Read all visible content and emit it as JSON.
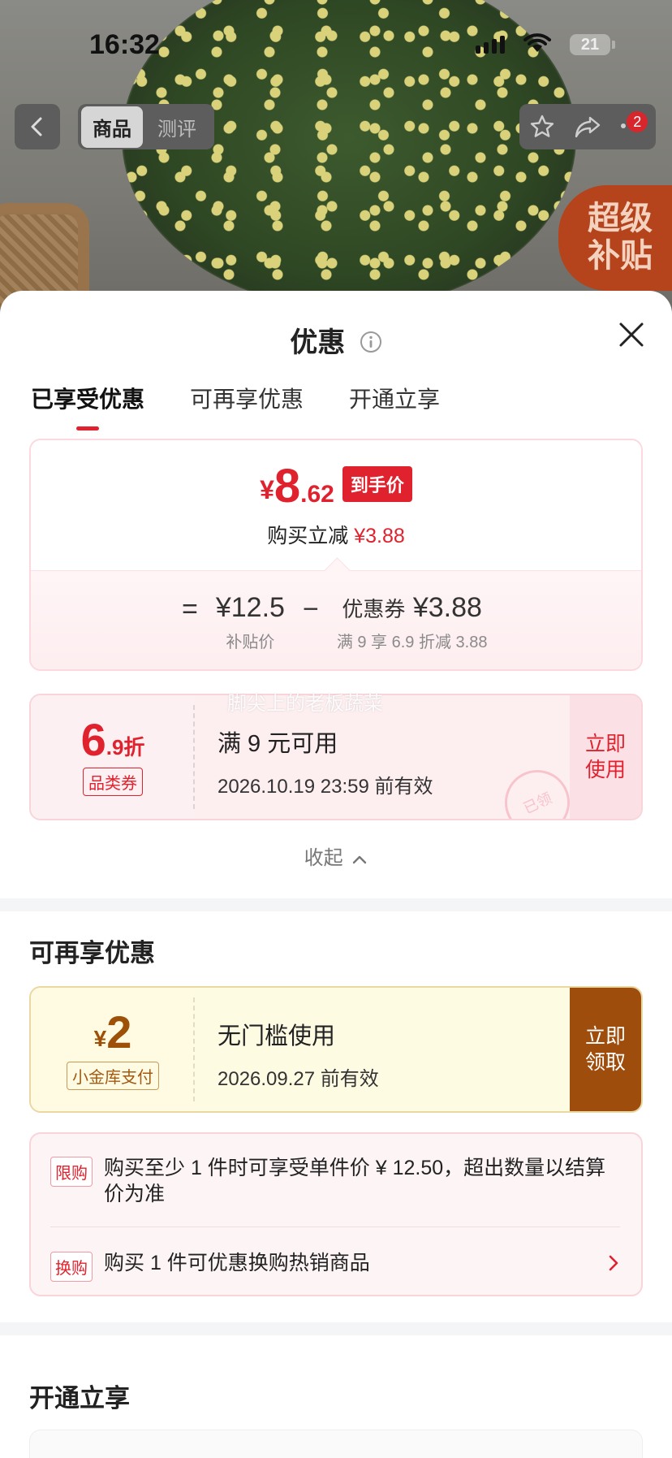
{
  "status_bar": {
    "time": "16:32",
    "battery": "21"
  },
  "nav": {
    "tabs": [
      {
        "label": "商品",
        "active": true
      },
      {
        "label": "测评",
        "active": false
      }
    ],
    "cart_badge": "2"
  },
  "background": {
    "subsidy_badge": [
      "超级",
      "补贴"
    ]
  },
  "sheet": {
    "title": "优惠",
    "tabs": [
      {
        "label": "已享受优惠",
        "active": true
      },
      {
        "label": "可再享优惠",
        "active": false
      },
      {
        "label": "开通立享",
        "active": false
      }
    ],
    "price_card": {
      "currency": "¥",
      "final_int": "8",
      "final_dec": ".62",
      "final_tag": "到手价",
      "instant_reduce_label": "购买立减",
      "instant_reduce_value": "¥3.88",
      "eq": "=",
      "minus": "−",
      "base_value": "¥12.5",
      "base_label": "补贴价",
      "coupon_prefix": "优惠券",
      "coupon_value": "¥3.88",
      "coupon_desc": "满 9 享 6.9 折减 3.88"
    },
    "watermark": "脚尖上的老板蔬菜",
    "coupon_used": {
      "discount_big": "6",
      "discount_small": ".9折",
      "type_tag": "品类券",
      "condition": "满 9 元可用",
      "valid": "2026.10.19 23:59 前有效",
      "action_lines": [
        "立即",
        "使用"
      ],
      "stamp": "已领"
    },
    "collapse_label": "收起",
    "more_section_title": "可再享优惠",
    "coupon_more": {
      "currency": "¥",
      "amount": "2",
      "type_tag": "小金库支付",
      "condition": "无门槛使用",
      "valid": "2026.09.27 前有效",
      "action_lines": [
        "立即",
        "领取"
      ]
    },
    "rules": [
      {
        "label": "限购",
        "text": "购买至少 1 件时可享受单件价 ¥ 12.50，超出数量以结算价为准"
      },
      {
        "label": "换购",
        "text": "购买 1 件可优惠换购热销商品"
      }
    ],
    "open_section_title": "开通立享"
  },
  "colors": {
    "accent_red": "#e0222e",
    "gold_brown": "#9e4d0c"
  }
}
